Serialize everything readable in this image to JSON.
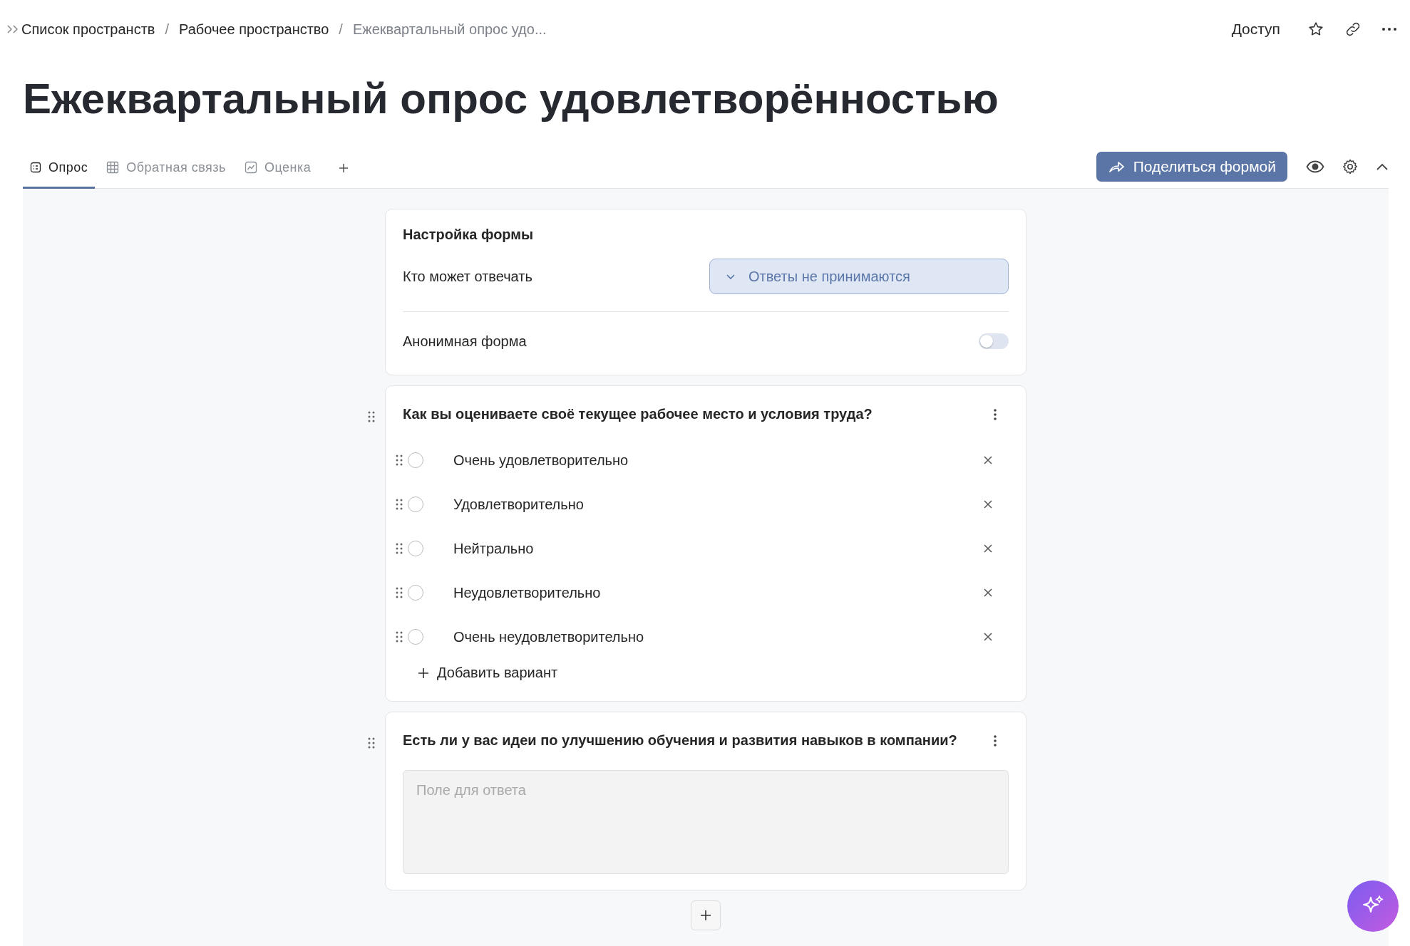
{
  "breadcrumbs": [
    {
      "label": "Список пространств",
      "kind": "link"
    },
    {
      "label": "/",
      "kind": "separator"
    },
    {
      "label": "Рабочее пространство",
      "kind": "link"
    },
    {
      "label": "/",
      "kind": "separator"
    },
    {
      "label": "Ежеквартальный опрос удо...",
      "kind": "current"
    }
  ],
  "header_actions": {
    "access": "Доступ"
  },
  "title": "Ежеквартальный опрос удовлетворённостью",
  "tabs": [
    {
      "label": "Опрос",
      "selected": true
    },
    {
      "label": "Обратная связь",
      "selected": false
    },
    {
      "label": "Оценка",
      "selected": false
    }
  ],
  "share_button": "Поделиться формой",
  "form_settings": {
    "title": "Настройка формы",
    "who_can_answer": "Кто может отвечать",
    "who_can_answer_value": "Ответы не принимаются",
    "anonymous": "Анонимная форма",
    "anonymous_on": false
  },
  "questions": [
    {
      "kind": "choice",
      "title": "Как вы оцениваете своё текущее рабочее место и условия труда?",
      "options": [
        {
          "label": "Очень удовлетворительно",
          "selected": false
        },
        {
          "label": "Удовлетворительно",
          "selected": false
        },
        {
          "label": "Нейтрально",
          "selected": false
        },
        {
          "label": "Неудовлетворительно",
          "selected": false
        },
        {
          "label": "Очень неудовлетворительно",
          "selected": false
        }
      ],
      "add_option": "Добавить вариант"
    },
    {
      "kind": "text",
      "title": "Есть ли у вас идеи по улучшению обучения и развития навыков в компании?",
      "placeholder": "Поле для ответа"
    }
  ]
}
